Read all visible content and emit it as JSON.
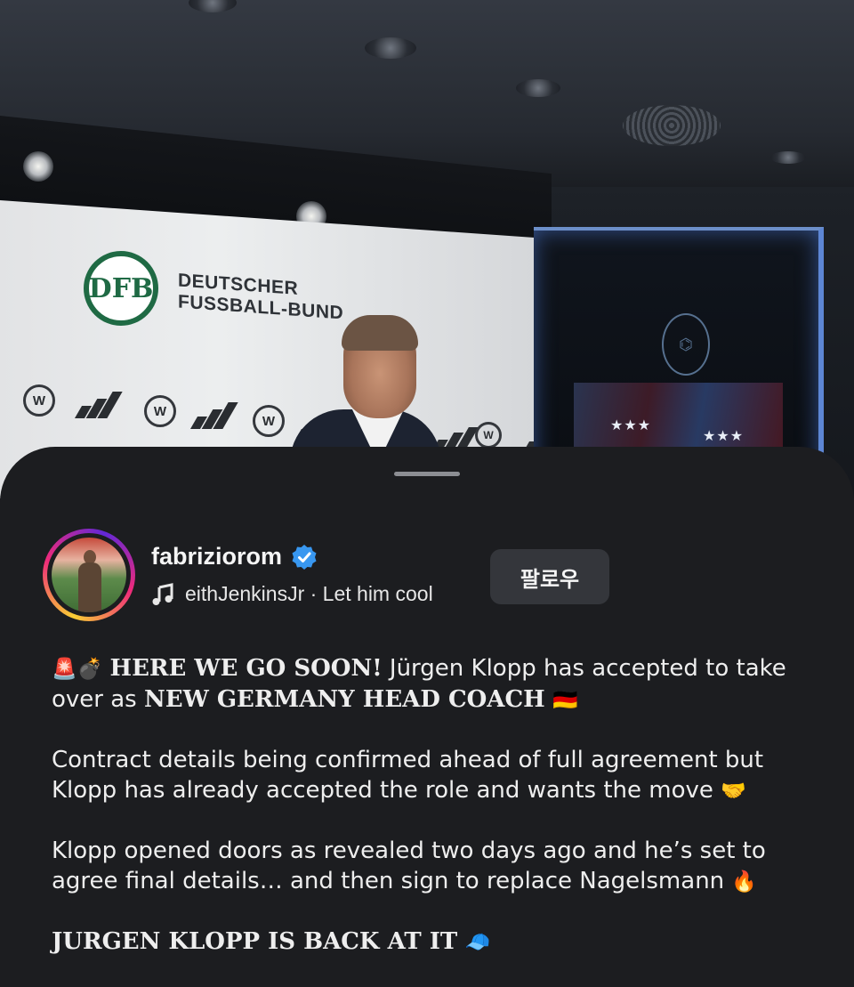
{
  "background_photo": {
    "backdrop_text": "DEUTSCHER\nFUSSBALL-BUND",
    "logo_text": "DFB"
  },
  "post": {
    "username": "fabriziorom",
    "verified": true,
    "music": "eithJenkinsJr · Let him cool",
    "follow_label": "팔로우",
    "caption": {
      "p1_emoji": "🚨💣",
      "p1_bold": "HERE WE GO SOON!",
      "p1_text": " Jürgen Klopp has accepted to take over as ",
      "p1_bold2": "NEW GERMANY HEAD COACH",
      "p1_flag": "🇩🇪",
      "p2": "Contract details being confirmed ahead of full agreement but Klopp has already accepted the role and wants the move",
      "p2_emoji": "🤝",
      "p3": "Klopp opened doors as revealed two days ago and he’s set to agree final details… and then sign to replace Nagelsmann",
      "p3_emoji": "🔥",
      "p4_bold": "JURGEN KLOPP IS BACK AT IT",
      "p4_emoji": "🧢"
    }
  },
  "colors": {
    "sheet_bg": "#1c1d20",
    "button_bg": "#34363b",
    "verified_blue": "#3897f0",
    "text": "#eeeeee"
  },
  "icons": [
    "verified-badge-icon",
    "music-note-icon"
  ]
}
